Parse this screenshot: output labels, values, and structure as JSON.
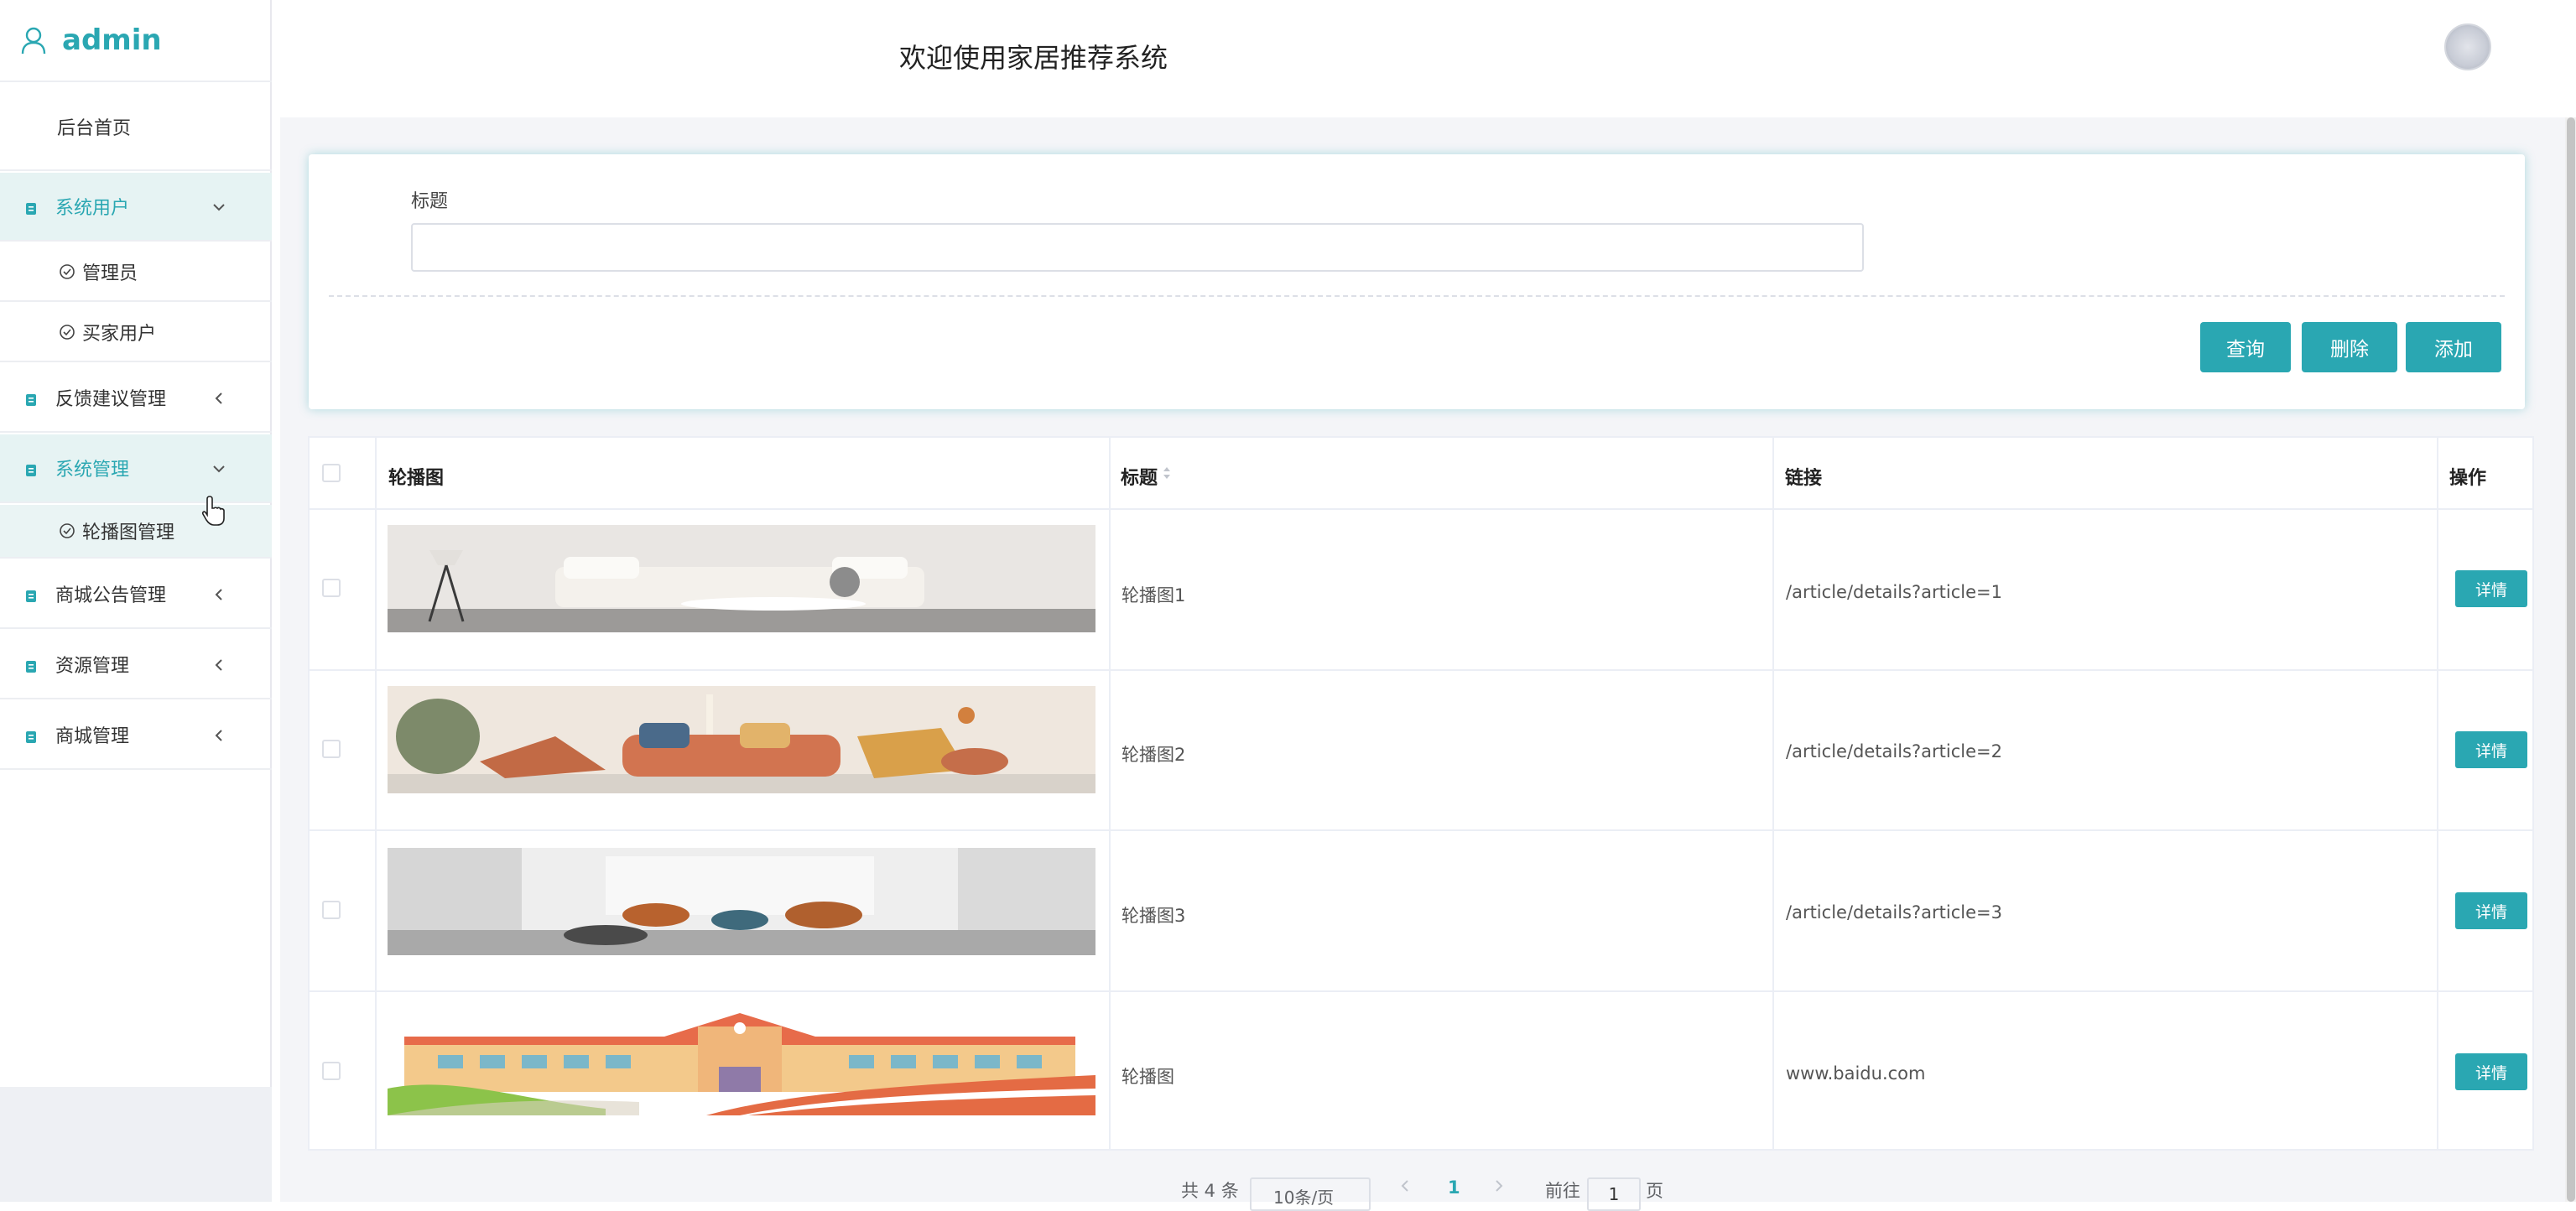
{
  "brand": {
    "name": "admin"
  },
  "sidebar": {
    "items": [
      {
        "label": "后台首页"
      },
      {
        "label": "系统用户",
        "children": [
          {
            "label": "管理员"
          },
          {
            "label": "买家用户"
          }
        ]
      },
      {
        "label": "反馈建议管理"
      },
      {
        "label": "系统管理",
        "children": [
          {
            "label": "轮播图管理"
          }
        ]
      },
      {
        "label": "商城公告管理"
      },
      {
        "label": "资源管理"
      },
      {
        "label": "商城管理"
      }
    ]
  },
  "header": {
    "title": "欢迎使用家居推荐系统"
  },
  "search": {
    "label": "标题",
    "value": ""
  },
  "actions": {
    "query": "查询",
    "delete": "删除",
    "add": "添加"
  },
  "table": {
    "headers": {
      "image": "轮播图",
      "title": "标题",
      "link": "链接",
      "ops": "操作"
    },
    "rows": [
      {
        "title": "轮播图1",
        "link": "/article/details?article=1",
        "action": "详情"
      },
      {
        "title": "轮播图2",
        "link": "/article/details?article=2",
        "action": "详情"
      },
      {
        "title": "轮播图3",
        "link": "/article/details?article=3",
        "action": "详情"
      },
      {
        "title": "轮播图",
        "link": "www.baidu.com",
        "action": "详情"
      }
    ]
  },
  "pagination": {
    "total": "共 4 条",
    "page_size": "10条/页",
    "current": "1",
    "goto_prefix": "前往",
    "goto_value": "1",
    "goto_suffix": "页"
  },
  "colors": {
    "accent": "#2aa7b2",
    "active_bg": "#e6f3f3"
  }
}
